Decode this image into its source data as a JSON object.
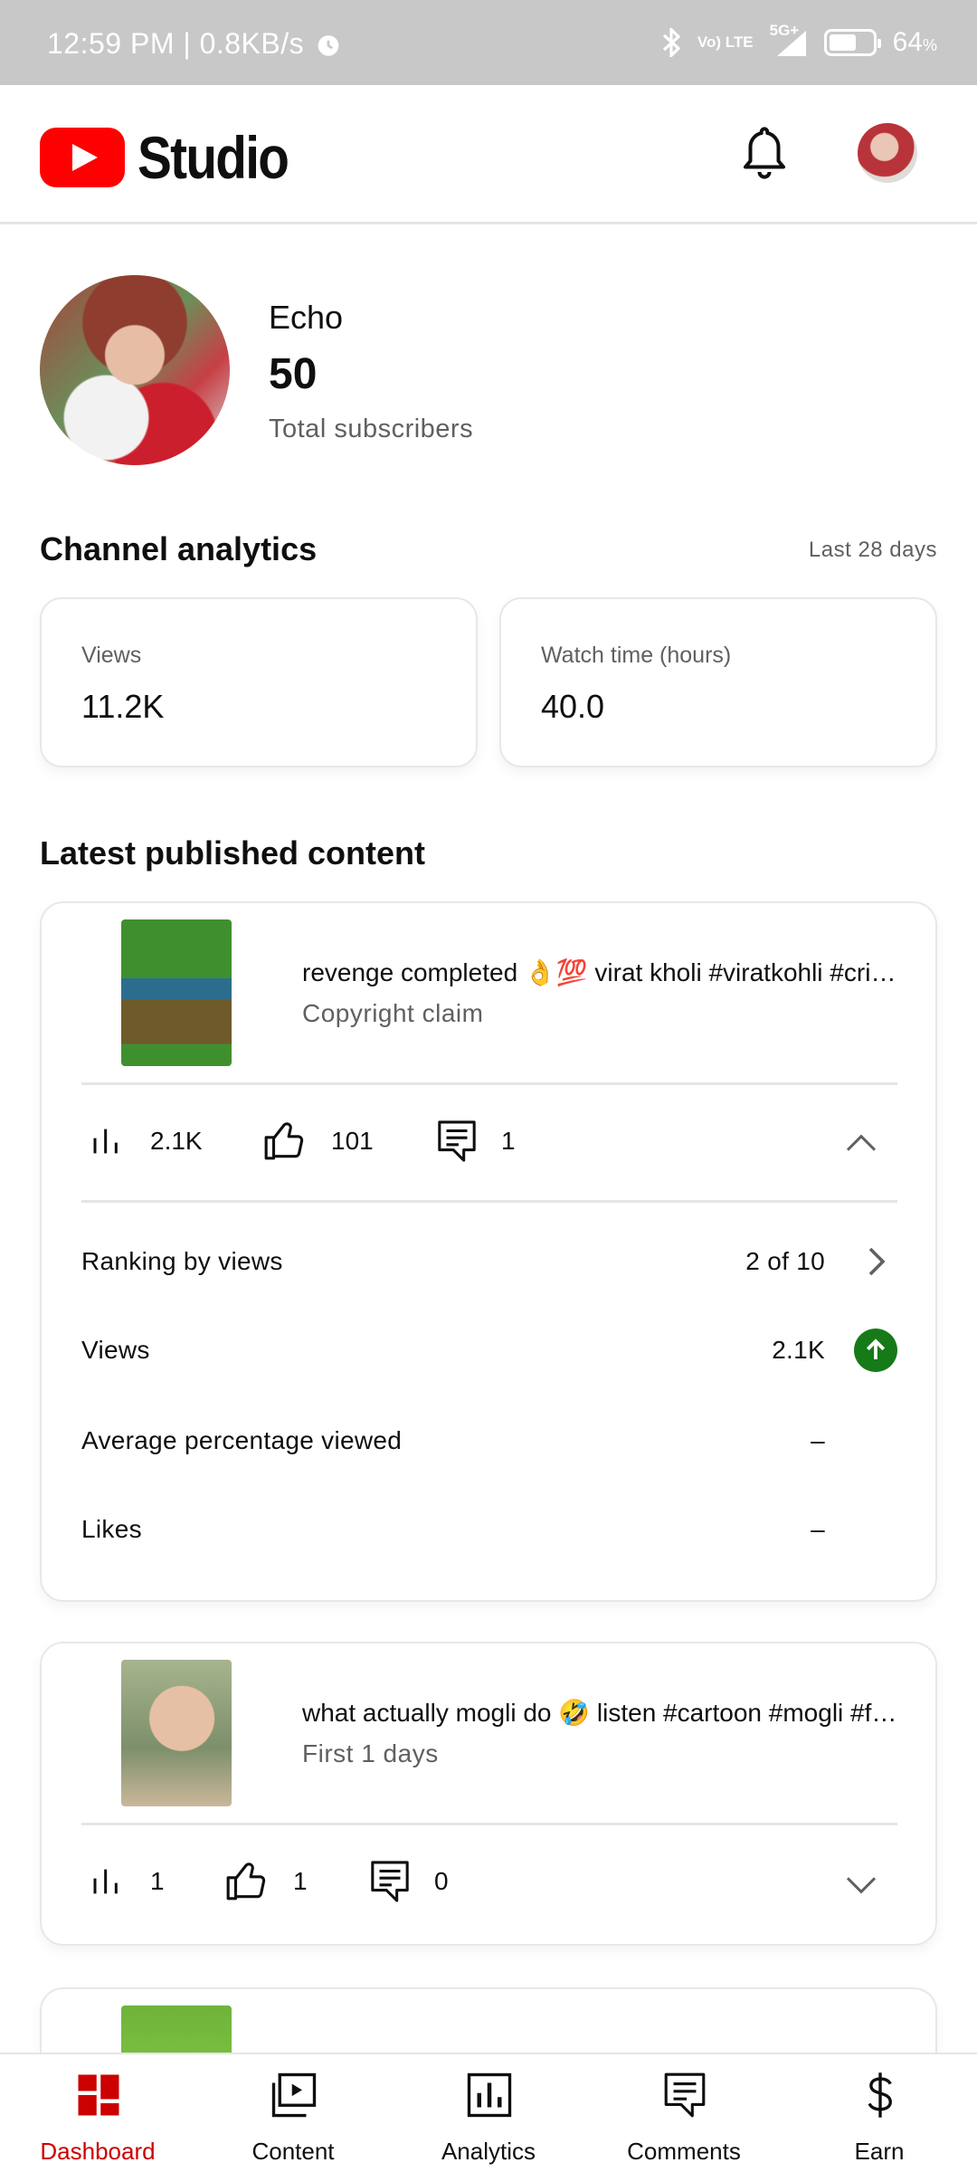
{
  "status_bar": {
    "time_speed": "12:59 PM | 0.8KB/s",
    "network": "Vo) LTE",
    "signal": "5G+",
    "battery": "64",
    "battery_unit": "%",
    "battery_level": 0.64
  },
  "header": {
    "logo_text": "Studio",
    "icons": [
      "youtube-logo-icon",
      "bell-icon",
      "account-avatar"
    ]
  },
  "profile": {
    "name": "Echo",
    "subscribers": "50",
    "subscribers_label": "Total subscribers"
  },
  "analytics": {
    "title": "Channel analytics",
    "period": "Last 28 days",
    "metrics": [
      {
        "label": "Views",
        "value": "11.2K"
      },
      {
        "label": "Watch time (hours)",
        "value": "40.0"
      }
    ]
  },
  "latest": {
    "title": "Latest published content",
    "items": [
      {
        "title": "revenge completed 👌💯 virat kholi #viratkohli #cricket",
        "subtitle": "Copyright claim",
        "views": "2.1K",
        "likes": "101",
        "comments": "1",
        "expanded": true,
        "details": [
          {
            "label": "Ranking by views",
            "value": "2 of 10"
          },
          {
            "label": "Views",
            "value": "2.1K"
          },
          {
            "label": "Average percentage viewed",
            "value": "–"
          },
          {
            "label": "Likes",
            "value": "–"
          }
        ]
      },
      {
        "title": "what actually mogli do 🤣 listen #cartoon #mogli #funny",
        "subtitle": "First 1 days",
        "views": "1",
        "likes": "1",
        "comments": "0",
        "expanded": false
      }
    ]
  },
  "bottom_nav": [
    {
      "label": "Dashboard",
      "icon": "dashboard-icon",
      "active": true
    },
    {
      "label": "Content",
      "icon": "content-icon",
      "active": false
    },
    {
      "label": "Analytics",
      "icon": "analytics-icon",
      "active": false
    },
    {
      "label": "Comments",
      "icon": "comments-icon",
      "active": false
    },
    {
      "label": "Earn",
      "icon": "dollar-icon",
      "active": false
    }
  ],
  "colors": {
    "accent": "#cc0000",
    "brand_red": "#ff0000",
    "trend_up": "#167a18"
  }
}
